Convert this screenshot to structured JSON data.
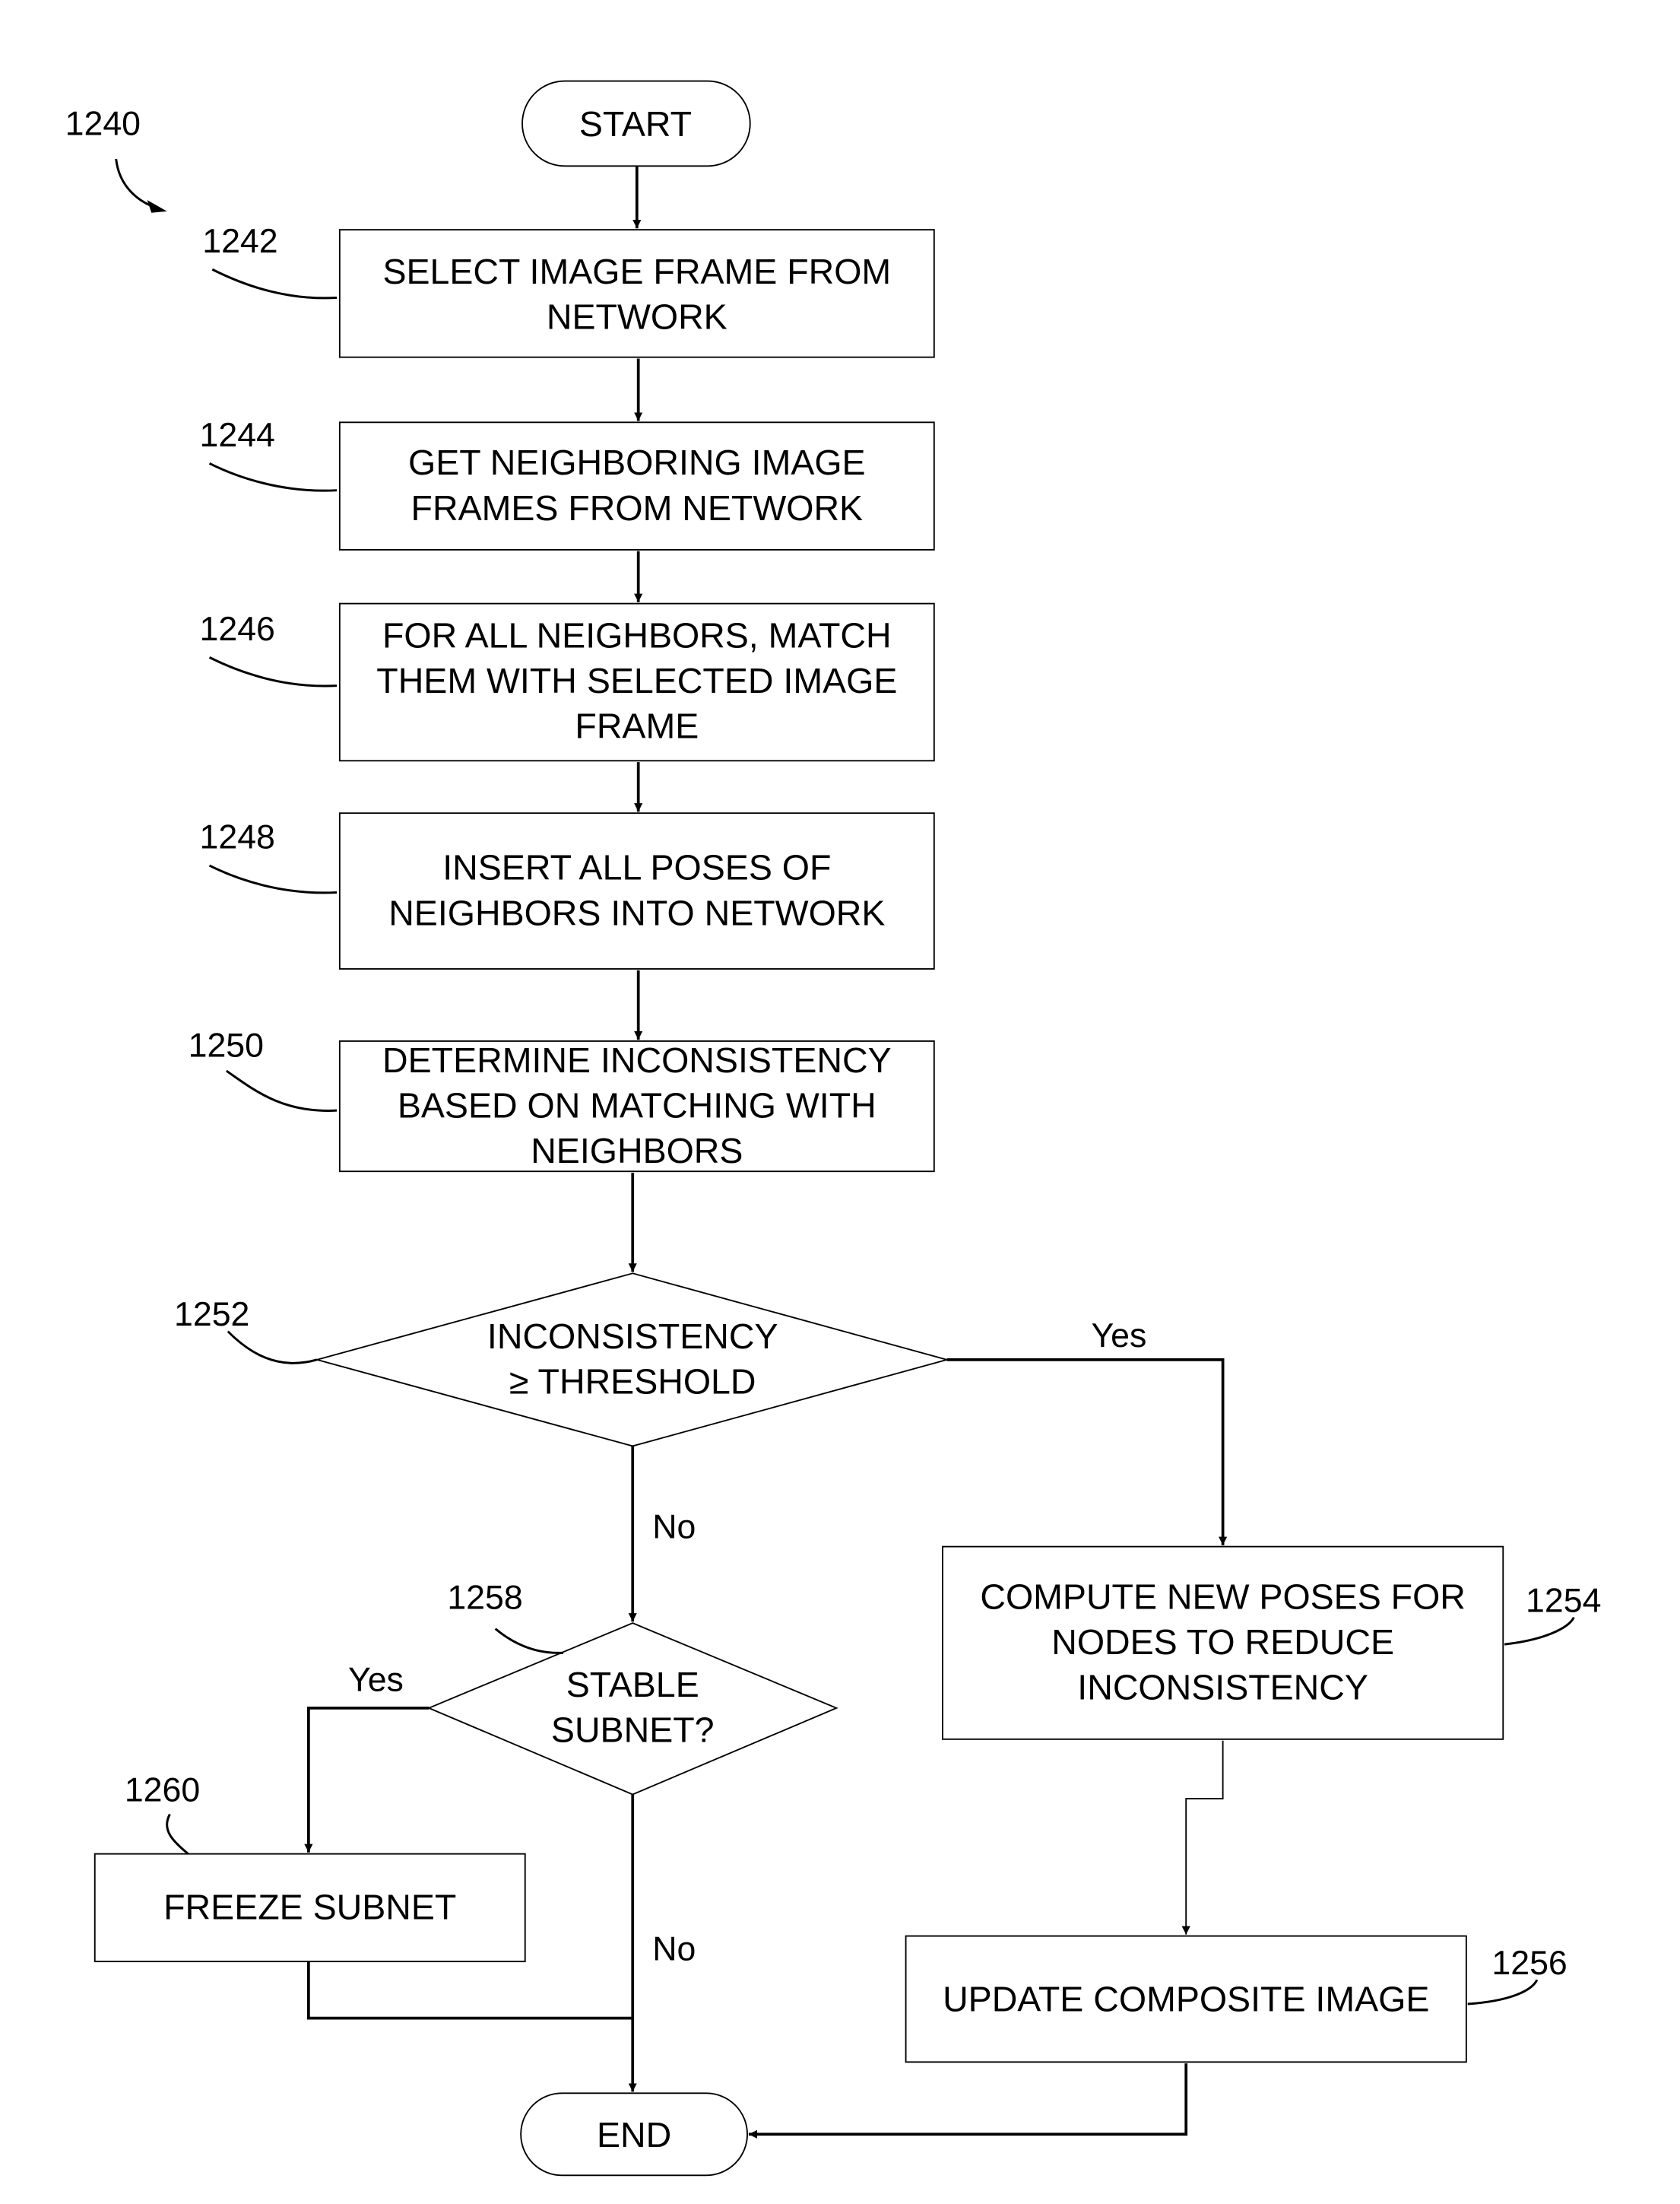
{
  "figure": {
    "reference": "1240",
    "nodes": {
      "start": {
        "label": "START"
      },
      "n1242": {
        "ref": "1242",
        "lines": [
          "SELECT IMAGE FRAME FROM",
          "NETWORK"
        ]
      },
      "n1244": {
        "ref": "1244",
        "lines": [
          "GET NEIGHBORING IMAGE",
          "FRAMES FROM NETWORK"
        ]
      },
      "n1246": {
        "ref": "1246",
        "lines": [
          "FOR ALL NEIGHBORS, MATCH",
          "THEM WITH SELECTED IMAGE",
          "FRAME"
        ]
      },
      "n1248": {
        "ref": "1248",
        "lines": [
          "INSERT ALL POSES OF",
          "NEIGHBORS INTO NETWORK"
        ]
      },
      "n1250": {
        "ref": "1250",
        "lines": [
          "DETERMINE INCONSISTENCY",
          "BASED ON MATCHING WITH",
          "NEIGHBORS"
        ]
      },
      "n1252": {
        "ref": "1252",
        "lines": [
          "INCONSISTENCY",
          "≥ THRESHOLD"
        ]
      },
      "n1254": {
        "ref": "1254",
        "lines": [
          "COMPUTE NEW POSES FOR",
          "NODES TO REDUCE",
          "INCONSISTENCY"
        ]
      },
      "n1256": {
        "ref": "1256",
        "lines": [
          "UPDATE COMPOSITE IMAGE"
        ]
      },
      "n1258": {
        "ref": "1258",
        "lines": [
          "STABLE",
          "SUBNET?"
        ]
      },
      "n1260": {
        "ref": "1260",
        "lines": [
          "FREEZE SUBNET"
        ]
      },
      "end": {
        "label": "END"
      }
    },
    "edge_labels": {
      "d1252_yes": "Yes",
      "d1252_no": "No",
      "d1258_yes": "Yes",
      "d1258_no": "No"
    }
  }
}
